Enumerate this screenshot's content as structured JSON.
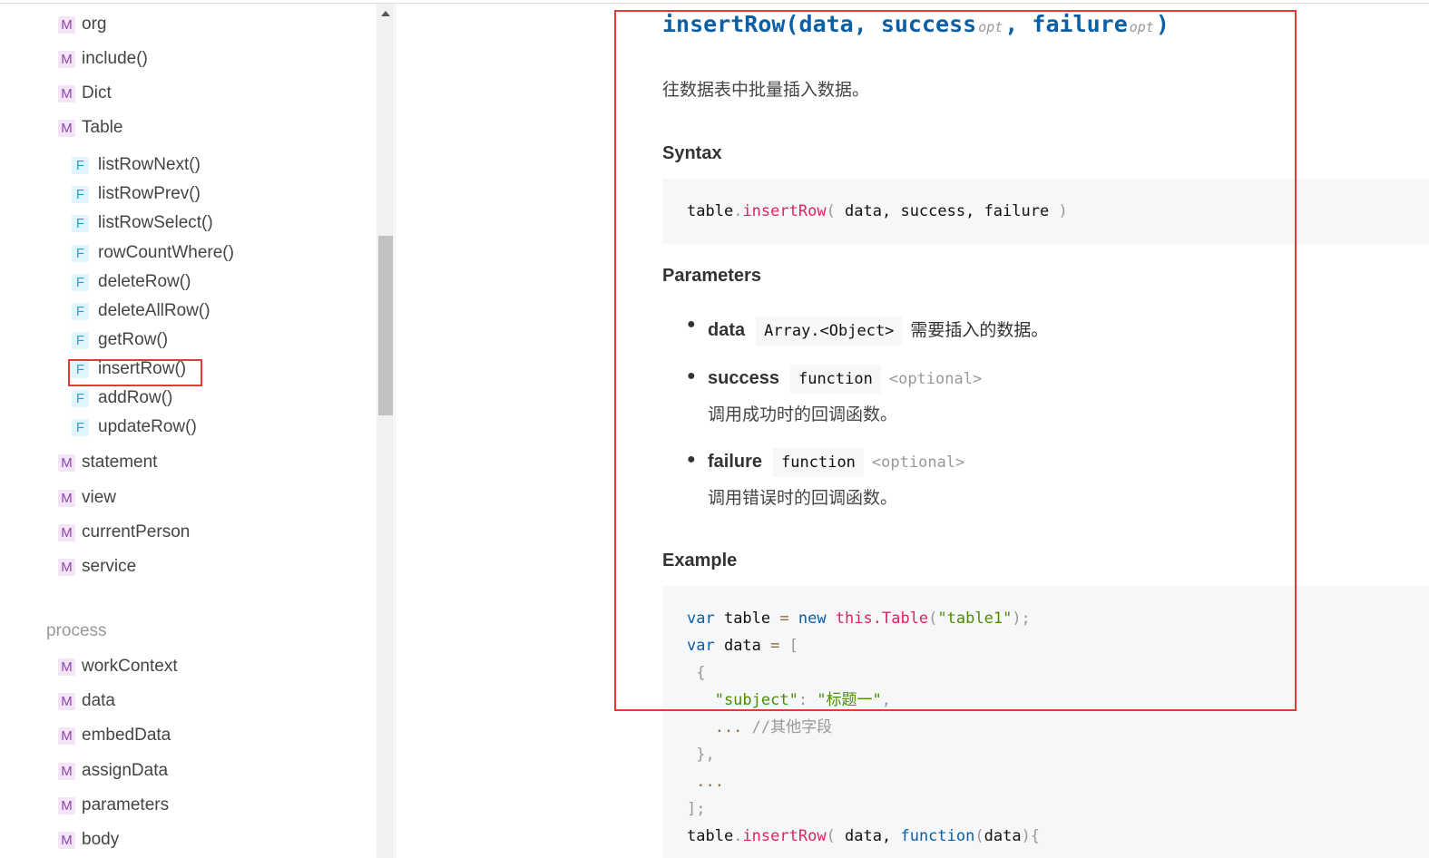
{
  "sidebar": {
    "items_top": [
      "org",
      "include()",
      "Dict",
      "Table"
    ],
    "table_functions": [
      "listRowNext()",
      "listRowPrev()",
      "listRowSelect()",
      "rowCountWhere()",
      "deleteRow()",
      "deleteAllRow()",
      "getRow()",
      "insertRow()",
      "addRow()",
      "updateRow()"
    ],
    "items_mid": [
      "statement",
      "view",
      "currentPerson",
      "service"
    ],
    "section_process": "process",
    "items_process": [
      "workContext",
      "data",
      "embedData",
      "assignData",
      "parameters",
      "body"
    ],
    "badge_m": "M",
    "badge_f": "F",
    "selected": "insertRow()"
  },
  "doc": {
    "title": {
      "name": "insertRow(data, ",
      "p2": "success",
      "opt": "opt",
      "sep": ", ",
      "p3": "failure",
      "close": ")"
    },
    "description": "往数据表中批量插入数据。",
    "syntax_heading": "Syntax",
    "syntax": {
      "obj": "table",
      "dot": ".",
      "method": "insertRow",
      "open": "( ",
      "args": "data, success, failure",
      "close": " )"
    },
    "parameters_heading": "Parameters",
    "parameters": [
      {
        "name": "data",
        "type": "Array.<Object>",
        "optional": "",
        "desc": "需要插入的数据。"
      },
      {
        "name": "success",
        "type": "function",
        "optional": "<optional>",
        "desc": "调用成功时的回调函数。"
      },
      {
        "name": "failure",
        "type": "function",
        "optional": "<optional>",
        "desc": "调用错误时的回调函数。"
      }
    ],
    "example_heading": "Example",
    "example": {
      "l1": {
        "kw": "var",
        "v": " table ",
        "eq": "=",
        "new": " new ",
        "fn": "this.Table",
        "p1": "(",
        "s": "\"table1\"",
        "p2": ");"
      },
      "l2": {
        "kw": "var",
        "v": " data ",
        "eq": "=",
        "p": " ["
      },
      "l3": " {",
      "l4": {
        "k": "   \"subject\"",
        "c": ": ",
        "s": "\"标题一\"",
        "p": ","
      },
      "l5": {
        "d": "   ...",
        "c": " //其他字段"
      },
      "l6": " },",
      "l7": " ...",
      "l8": "];",
      "l9": {
        "obj": "table",
        "dot": ".",
        "fn": "insertRow",
        "p": "( ",
        "a": "data, ",
        "kw": "function",
        "p2": "(",
        "a2": "data",
        "p3": "){"
      }
    }
  }
}
